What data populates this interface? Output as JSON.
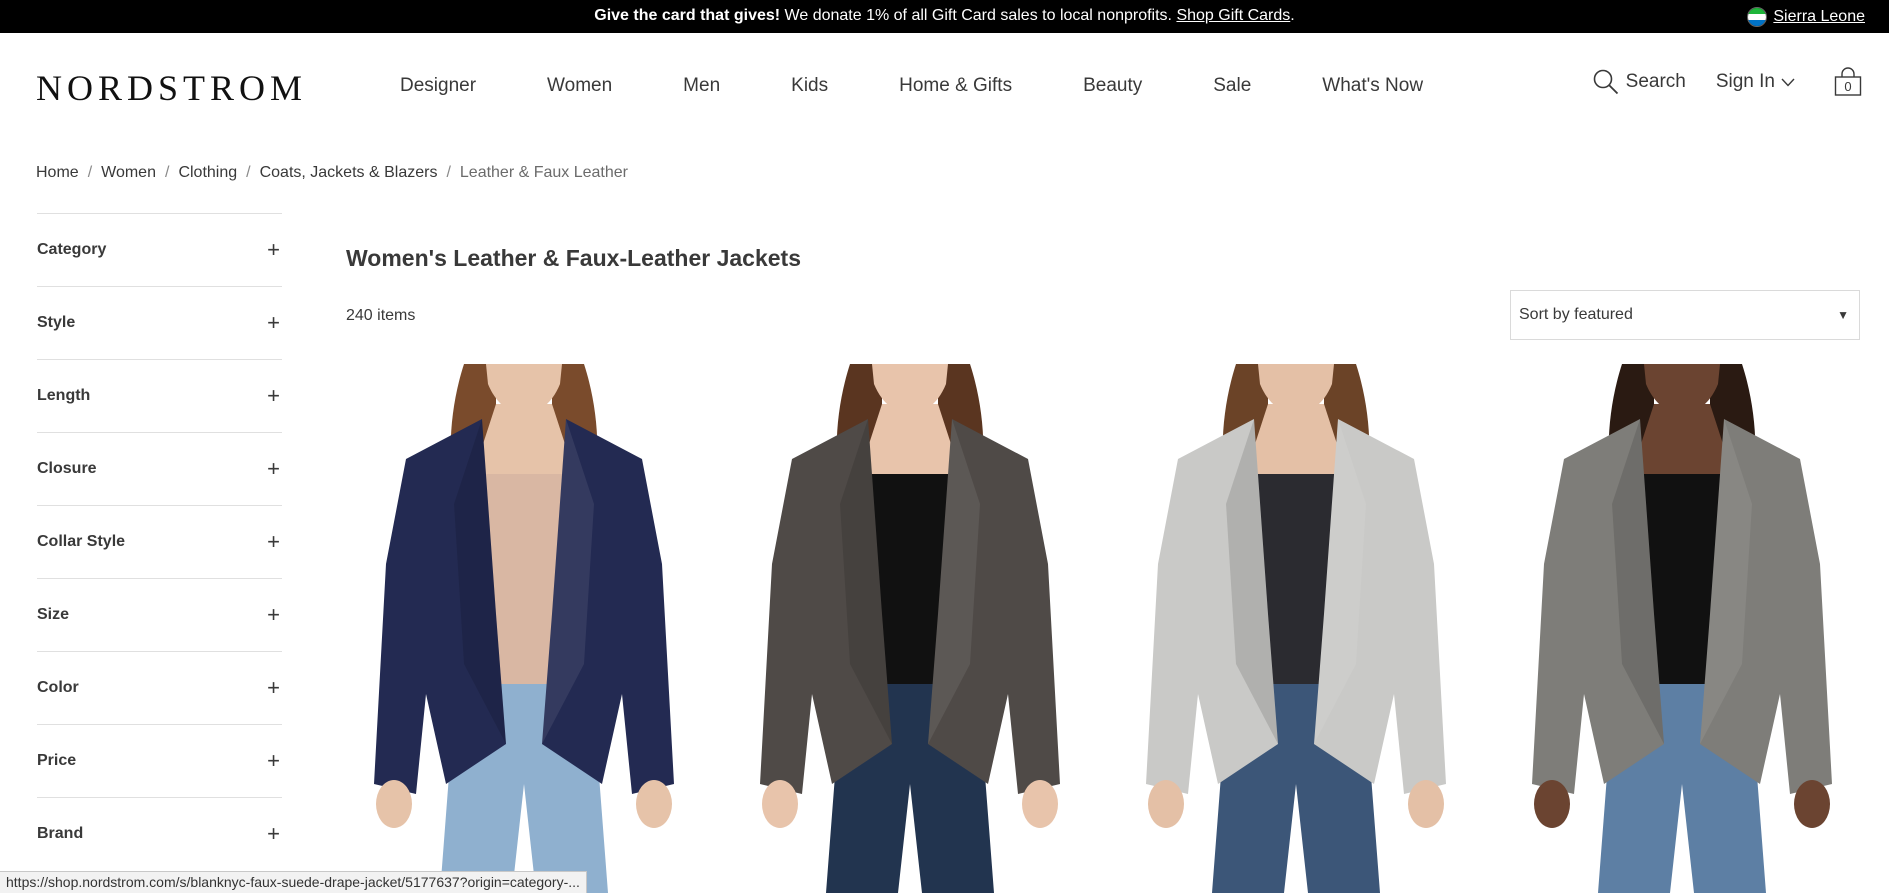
{
  "promo": {
    "bold": "Give the card that gives!",
    "text": " We donate 1% of all Gift Card sales to local nonprofits. ",
    "link": "Shop Gift Cards",
    "end": ".",
    "country": "Sierra Leone"
  },
  "header": {
    "logo": "NORDSTROM",
    "nav": [
      "Designer",
      "Women",
      "Men",
      "Kids",
      "Home & Gifts",
      "Beauty",
      "Sale",
      "What's Now"
    ],
    "search_label": "Search",
    "signin_label": "Sign In",
    "bag_count": "0"
  },
  "breadcrumb": [
    "Home",
    "Women",
    "Clothing",
    "Coats, Jackets & Blazers",
    "Leather & Faux Leather"
  ],
  "filters": [
    "Category",
    "Style",
    "Length",
    "Closure",
    "Collar Style",
    "Size",
    "Color",
    "Price",
    "Brand"
  ],
  "main": {
    "title": "Women's Leather & Faux-Leather Jackets",
    "count": "240 items",
    "sort": "Sort by featured"
  },
  "products": [
    {
      "jacket_color": "#232a52",
      "top_color": "#d9b7a3",
      "jeans_color": "#8fb0cf",
      "skin": "#e6c3a9",
      "hair": "#7a4b2c"
    },
    {
      "jacket_color": "#4f4a47",
      "top_color": "#111111",
      "jeans_color": "#22344f",
      "skin": "#e8c4ab",
      "hair": "#5a3520"
    },
    {
      "jacket_color": "#c9c9c7",
      "top_color": "#2b2b30",
      "jeans_color": "#3c5678",
      "skin": "#e4c0a6",
      "hair": "#6b4327"
    },
    {
      "jacket_color": "#7e7d79",
      "top_color": "#111111",
      "jeans_color": "#5d7fa4",
      "skin": "#6b4431",
      "hair": "#2a1a12"
    }
  ],
  "status_url": "https://shop.nordstrom.com/s/blanknyc-faux-suede-drape-jacket/5177637?origin=category-..."
}
